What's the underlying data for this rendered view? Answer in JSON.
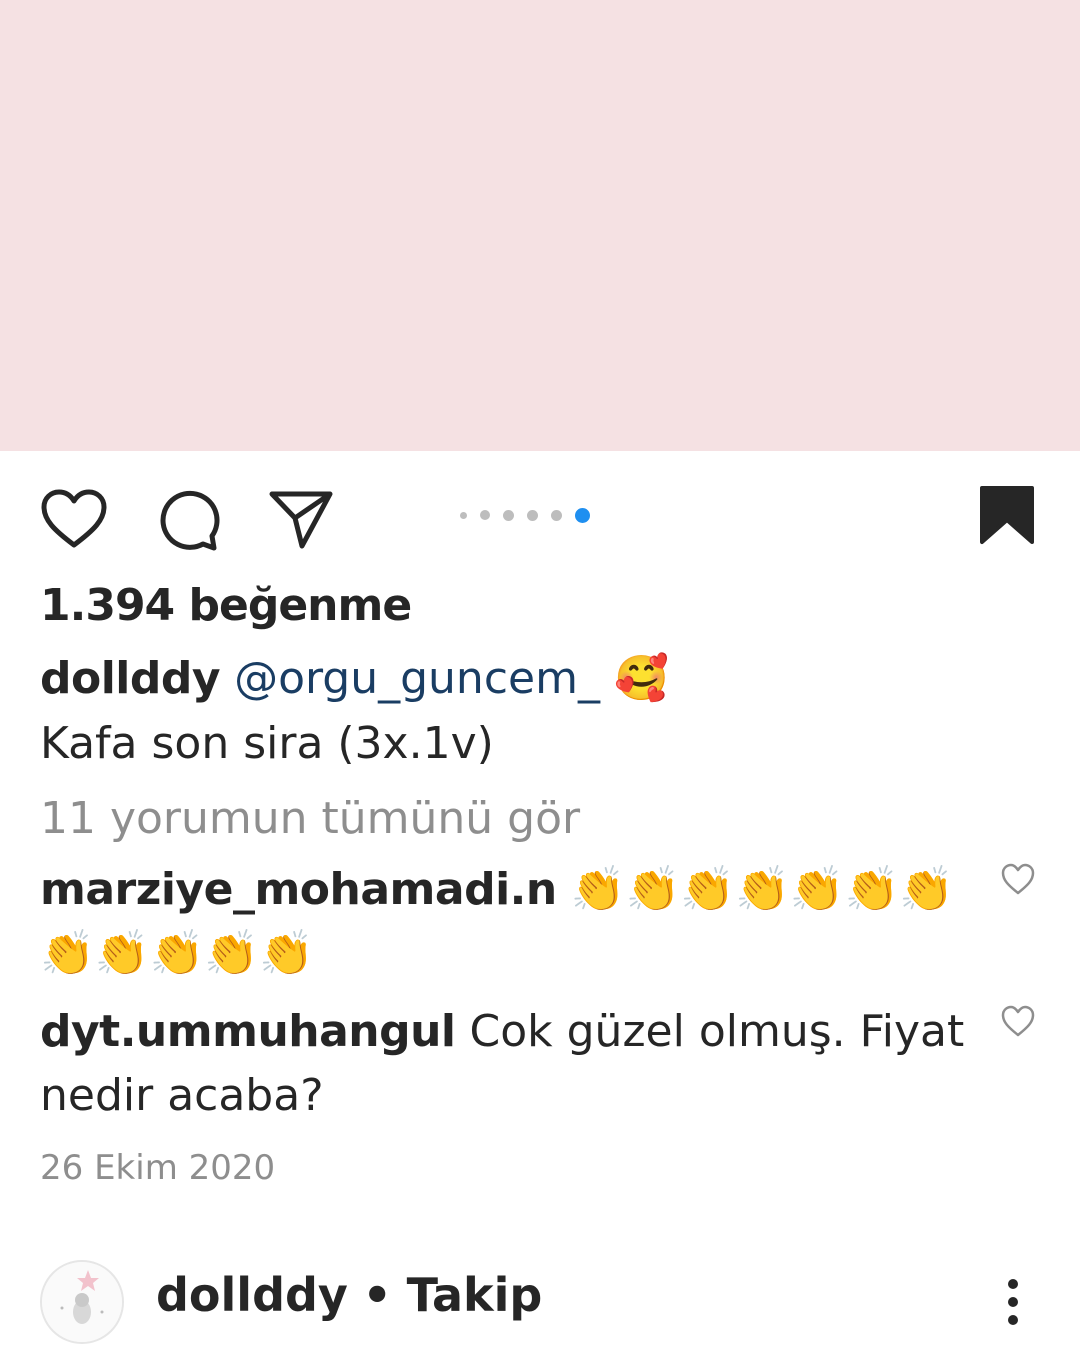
{
  "post": {
    "likes": "1.394 beğenme",
    "caption_user": "dollddy",
    "caption_mention": "@orgu_guncem_",
    "caption_emoji": "🥰",
    "caption_text": "Kafa son sira (3x.1v)",
    "view_all_comments": "11 yorumun tümünü gör",
    "date": "26 Ekim 2020",
    "carousel": {
      "count": 6,
      "active_index": 6
    }
  },
  "comments": [
    {
      "user": "marziye_mohamadi.n",
      "text": "👏👏👏👏👏👏👏👏👏👏👏👏"
    },
    {
      "user": "dyt.ummuhangul",
      "text": "Cok güzel olmuş. Fiyat nedir acaba?"
    }
  ],
  "author": {
    "username": "dollddy",
    "separator": "•",
    "follow_label": "Takip"
  },
  "colors": {
    "image_placeholder": "#f5e1e3",
    "accent": "#1f8ff0",
    "mention": "#1a3d63",
    "muted": "#8e8e8e"
  },
  "icons": [
    "heart-icon",
    "comment-icon",
    "share-icon",
    "bookmark-icon",
    "comment-like-icon",
    "more-options-icon"
  ]
}
